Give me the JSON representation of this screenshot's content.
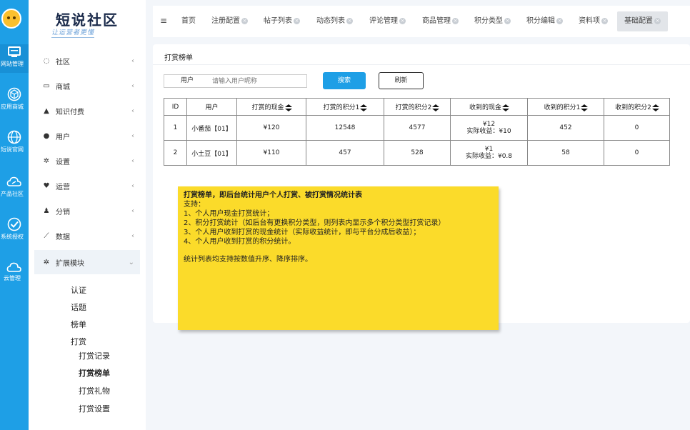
{
  "rail": {
    "items": [
      {
        "label": "网站管理",
        "icon": "monitor-icon"
      },
      {
        "label": "应用商城",
        "icon": "cube-icon"
      },
      {
        "label": "短说官网",
        "icon": "globe-icon"
      },
      {
        "label": "产品社区",
        "icon": "link-cloud-icon"
      },
      {
        "label": "系统授权",
        "icon": "shield-check-icon"
      },
      {
        "label": "云管理",
        "icon": "cloud-icon"
      }
    ]
  },
  "brand": {
    "name": "短说社区",
    "slogan": "让运营者更懂"
  },
  "sidebar": {
    "items": [
      {
        "label": "社区",
        "icon": "comment-icon"
      },
      {
        "label": "商城",
        "icon": "laptop-icon"
      },
      {
        "label": "知识付费",
        "icon": "graduation-cap-icon"
      },
      {
        "label": "用户",
        "icon": "user-icon"
      },
      {
        "label": "设置",
        "icon": "gear-icon"
      },
      {
        "label": "运营",
        "icon": "heartbeat-icon"
      },
      {
        "label": "分销",
        "icon": "users-icon"
      },
      {
        "label": "数据",
        "icon": "chart-icon"
      },
      {
        "label": "扩展模块",
        "icon": "gear-icon"
      }
    ],
    "sub": [
      "认证",
      "话题",
      "榜单",
      "打赏"
    ],
    "subsub": [
      "打赏记录",
      "打赏榜单",
      "打赏礼物",
      "打赏设置"
    ]
  },
  "tabs": [
    "首页",
    "注册配置",
    "帖子列表",
    "动态列表",
    "评论管理",
    "商品管理",
    "积分类型",
    "积分编辑",
    "资料项",
    "基础配置"
  ],
  "panel": {
    "title": "打赏榜单",
    "filter_label": "用户",
    "filter_placeholder": "请输入用户昵称",
    "search": "搜索",
    "refresh": "刷新"
  },
  "table": {
    "headers": [
      "ID",
      "用户",
      "打赏的现金",
      "打赏的积分1",
      "打赏的积分2",
      "收到的现金",
      "收到的积分1",
      "收到的积分2"
    ],
    "rows": [
      {
        "id": "1",
        "user": "小番茄【01】",
        "cash": "¥120",
        "p1": "12548",
        "p2": "4577",
        "recv_cash": "¥12",
        "recv_net": "实际收益：¥10",
        "rp1": "452",
        "rp2": "0"
      },
      {
        "id": "2",
        "user": "小土豆【01】",
        "cash": "¥110",
        "p1": "457",
        "p2": "528",
        "recv_cash": "¥1",
        "recv_net": "实际收益：¥0.8",
        "rp1": "58",
        "rp2": "0"
      }
    ]
  },
  "note": {
    "title": "打赏榜单，即后台统计用户个人打赏、被打赏情况统计表",
    "support": "支持：",
    "lines": [
      "1、个人用户现金打赏统计；",
      "2、积分打赏统计（如后台有更换积分类型，则列表内显示多个积分类型打赏记录）",
      "3、个人用户收到打赏的现金统计（实际收益统计，即与平台分成后收益）；",
      "4、个人用户收到打赏的积分统计。"
    ],
    "footer": "统计列表均支持按数值升序、降序排序。"
  }
}
